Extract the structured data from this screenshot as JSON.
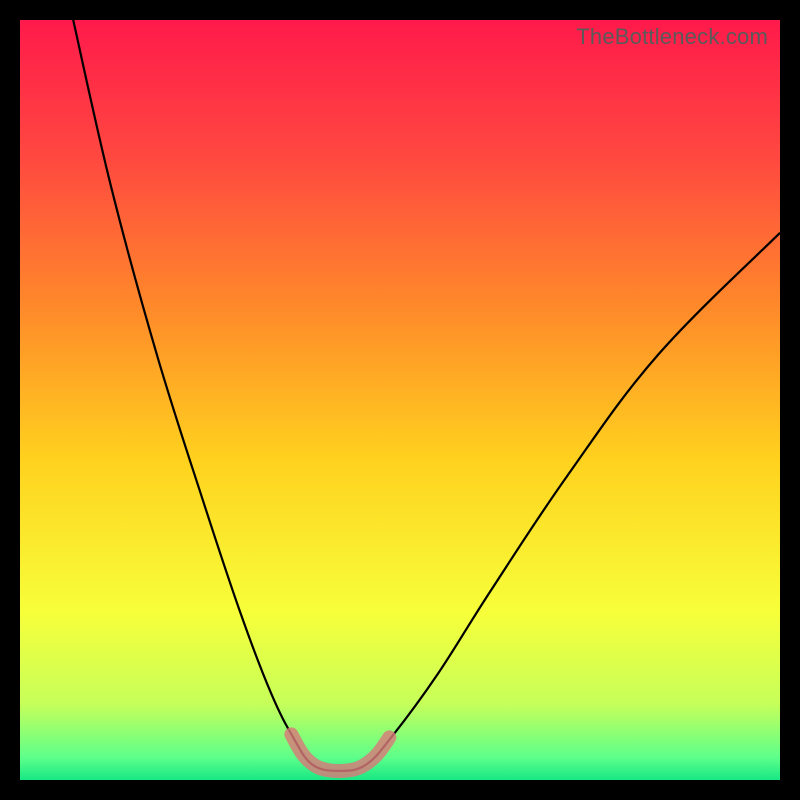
{
  "watermark": "TheBottleneck.com",
  "chart_data": {
    "type": "line",
    "title": "",
    "xlabel": "",
    "ylabel": "",
    "xlim": [
      0,
      100
    ],
    "ylim": [
      0,
      100
    ],
    "grid": false,
    "legend": false,
    "gradient_stops": [
      {
        "offset": 0.0,
        "color": "#ff1a4b"
      },
      {
        "offset": 0.18,
        "color": "#ff4840"
      },
      {
        "offset": 0.38,
        "color": "#ff8a2a"
      },
      {
        "offset": 0.58,
        "color": "#ffd21e"
      },
      {
        "offset": 0.78,
        "color": "#f7ff3a"
      },
      {
        "offset": 0.9,
        "color": "#c6ff5a"
      },
      {
        "offset": 0.97,
        "color": "#5eff8a"
      },
      {
        "offset": 1.0,
        "color": "#17e884"
      }
    ],
    "series": [
      {
        "name": "bottleneck-curve",
        "stroke": "#000000",
        "stroke_width": 2.2,
        "points": [
          {
            "x": 7.0,
            "y": 100.0
          },
          {
            "x": 12.0,
            "y": 78.0
          },
          {
            "x": 18.0,
            "y": 56.0
          },
          {
            "x": 24.0,
            "y": 37.0
          },
          {
            "x": 29.0,
            "y": 22.0
          },
          {
            "x": 33.0,
            "y": 11.5
          },
          {
            "x": 36.0,
            "y": 5.5
          },
          {
            "x": 38.5,
            "y": 2.0
          },
          {
            "x": 42.0,
            "y": 1.2
          },
          {
            "x": 45.5,
            "y": 2.0
          },
          {
            "x": 49.0,
            "y": 5.8
          },
          {
            "x": 55.0,
            "y": 14.0
          },
          {
            "x": 62.0,
            "y": 25.0
          },
          {
            "x": 72.0,
            "y": 40.0
          },
          {
            "x": 84.0,
            "y": 56.0
          },
          {
            "x": 100.0,
            "y": 72.0
          }
        ]
      },
      {
        "name": "highlight-band",
        "stroke": "#d97a7a",
        "stroke_width": 14,
        "opacity": 0.82,
        "linecap": "round",
        "points": [
          {
            "x": 35.7,
            "y": 6.0
          },
          {
            "x": 37.2,
            "y": 3.4
          },
          {
            "x": 38.8,
            "y": 1.9
          },
          {
            "x": 40.5,
            "y": 1.3
          },
          {
            "x": 42.5,
            "y": 1.2
          },
          {
            "x": 44.3,
            "y": 1.5
          },
          {
            "x": 45.8,
            "y": 2.3
          },
          {
            "x": 47.2,
            "y": 3.6
          },
          {
            "x": 48.6,
            "y": 5.6
          }
        ]
      }
    ]
  }
}
